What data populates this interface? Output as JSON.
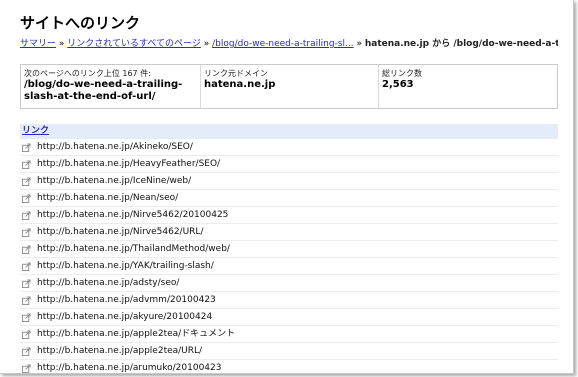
{
  "page": {
    "title": "サイトへのリンク"
  },
  "breadcrumb": {
    "summary": "サマリー",
    "sep1": "»",
    "all_linked": "リンクされているすべてのページ",
    "sep2": "»",
    "target_page": "/blog/do-we-need-a-trailing-sl...",
    "sep3": "»",
    "current": "hatena.ne.jp から /blog/do-we-need-a-trailing-sl... へのリンク"
  },
  "summary": {
    "target_label": "次のページへのリンク上位 167 件:",
    "target_value": "/blog/do-we-need-a-trailing-slash-at-the-end-of-url/",
    "domain_label": "リンク元ドメイン",
    "domain_value": "hatena.ne.jp",
    "total_label": "総リンク数",
    "total_value": "2,563"
  },
  "links": {
    "header": "リンク",
    "items": [
      "http://b.hatena.ne.jp/Akineko/SEO/",
      "http://b.hatena.ne.jp/HeavyFeather/SEO/",
      "http://b.hatena.ne.jp/IceNine/web/",
      "http://b.hatena.ne.jp/Nean/seo/",
      "http://b.hatena.ne.jp/Nirve5462/20100425",
      "http://b.hatena.ne.jp/Nirve5462/URL/",
      "http://b.hatena.ne.jp/ThailandMethod/web/",
      "http://b.hatena.ne.jp/YAK/trailing-slash/",
      "http://b.hatena.ne.jp/adsty/seo/",
      "http://b.hatena.ne.jp/advmm/20100423",
      "http://b.hatena.ne.jp/akyure/20100424",
      "http://b.hatena.ne.jp/apple2tea/ドキュメント",
      "http://b.hatena.ne.jp/apple2tea/URL/",
      "http://b.hatena.ne.jp/arumuko/20100423"
    ]
  },
  "icons": {
    "link_row_icon": "external-link-icon"
  },
  "colors": {
    "link": "#2a2ac8",
    "header_bg": "#e5ecf9"
  }
}
